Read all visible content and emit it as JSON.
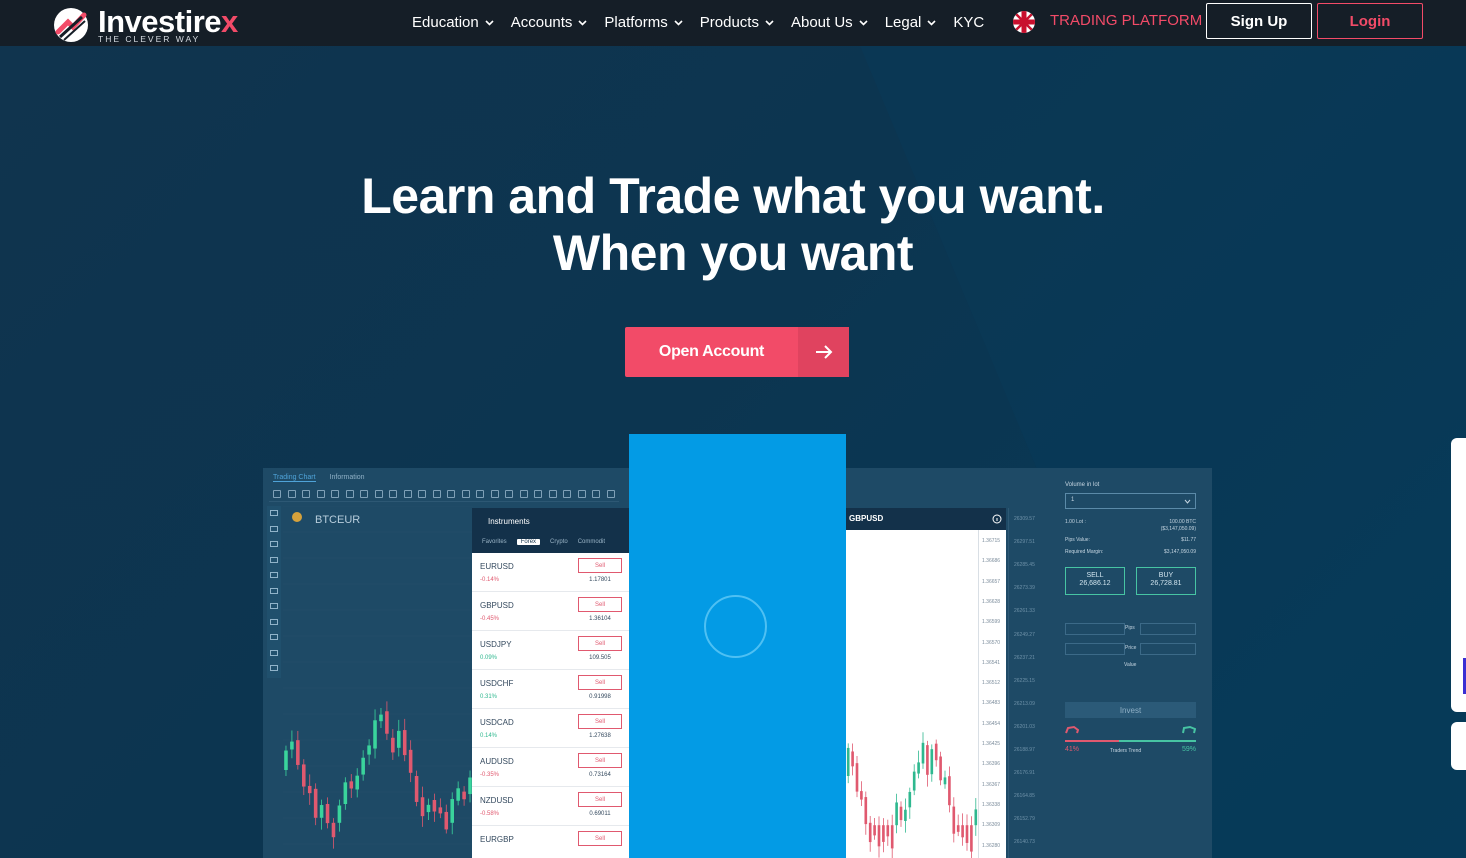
{
  "brand": {
    "name_main": "Investire",
    "name_accent": "x",
    "tagline": "THE CLEVER WAY",
    "accent_color": "#f24b68"
  },
  "nav": {
    "items": [
      {
        "label": "Education",
        "has_dropdown": true
      },
      {
        "label": "Accounts",
        "has_dropdown": true
      },
      {
        "label": "Platforms",
        "has_dropdown": true
      },
      {
        "label": "Products",
        "has_dropdown": true
      },
      {
        "label": "About Us",
        "has_dropdown": true
      },
      {
        "label": "Legal",
        "has_dropdown": true
      },
      {
        "label": "KYC",
        "has_dropdown": false
      }
    ],
    "language_flag": "uk-flag-icon",
    "trading_platform": "TRADING PLATFORM",
    "signup": "Sign Up",
    "login": "Login"
  },
  "hero": {
    "line1": "Learn and Trade what you want.",
    "line2": "When you want",
    "cta": "Open Account"
  },
  "mockup": {
    "tabs": [
      "Trading Chart",
      "Information"
    ],
    "chart_symbol": "BTCEUR",
    "instruments": {
      "title": "Instruments",
      "tabs": [
        "Favorites",
        "Forex",
        "Crypto",
        "Commodit"
      ],
      "sell_label": "Sell",
      "rows": [
        {
          "symbol": "EURUSD",
          "change": "-0.14%",
          "price": "1.17801",
          "negative": true
        },
        {
          "symbol": "GBPUSD",
          "change": "-0.45%",
          "price": "1.36104",
          "negative": true
        },
        {
          "symbol": "USDJPY",
          "change": "0.09%",
          "price": "109.505",
          "negative": false
        },
        {
          "symbol": "USDCHF",
          "change": "0.31%",
          "price": "0.91998",
          "negative": false
        },
        {
          "symbol": "USDCAD",
          "change": "0.14%",
          "price": "1.27638",
          "negative": false
        },
        {
          "symbol": "AUDUSD",
          "change": "-0.35%",
          "price": "0.73164",
          "negative": true
        },
        {
          "symbol": "NZDUSD",
          "change": "-0.58%",
          "price": "0.69011",
          "negative": true
        },
        {
          "symbol": "EURGBP",
          "change": "",
          "price": "",
          "negative": false
        }
      ]
    },
    "gbp_panel": {
      "title": "GBPUSD",
      "prices": [
        "1.36715",
        "1.36686",
        "1.36657",
        "1.36628",
        "1.36599",
        "1.36570",
        "1.36541",
        "1.36512",
        "1.36483",
        "1.36454",
        "1.36425",
        "1.36396",
        "1.36367",
        "1.36338",
        "1.36309",
        "1.36280"
      ]
    },
    "dark_axis": [
      "26309.57",
      "26297.51",
      "26285.45",
      "26273.39",
      "26261.33",
      "26249.27",
      "26237.21",
      "26225.15",
      "26213.09",
      "26201.03",
      "26188.97",
      "26176.91",
      "26164.85",
      "26152.79",
      "26140.73"
    ],
    "order": {
      "volume_label": "Volume in lot",
      "volume_value": "1",
      "lot_label": "1.00 Lot :",
      "lot_value": "100.00 BTC",
      "lot_value2": "($3,147,050.09)",
      "pips_label": "Pips Value:",
      "pips_value": "$11.77",
      "margin_label": "Required Margin:",
      "margin_value": "$3,147,050.09",
      "sell_label": "SELL",
      "sell_price": "26,686.12",
      "buy_label": "BUY",
      "buy_price": "26,728.81",
      "pips": "Pips",
      "price": "Price",
      "value": "Value",
      "invest": "Invest",
      "traders_trend": "Traders Trend",
      "sell_pct": "41%",
      "buy_pct": "59%",
      "sell_fraction": 0.41
    }
  }
}
